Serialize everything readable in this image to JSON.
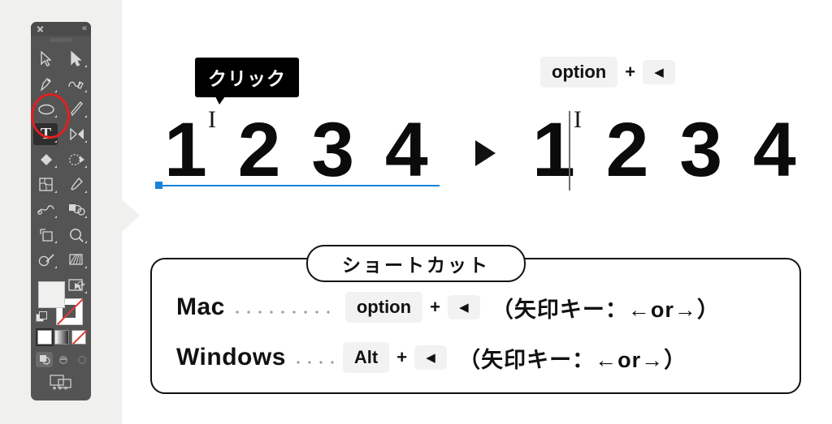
{
  "toolbar": {
    "close_icon": "close-icon",
    "collapse_label": "«",
    "dots_label": "•••",
    "tools": [
      {
        "name": "selection-tool",
        "glyph": "▷"
      },
      {
        "name": "direct-selection-tool",
        "glyph": "▶"
      },
      {
        "name": "pen-tool",
        "glyph": "✒"
      },
      {
        "name": "curvature-tool",
        "glyph": "✎"
      },
      {
        "name": "ellipse-tool",
        "glyph": "⬭"
      },
      {
        "name": "paintbrush-tool",
        "glyph": "╱"
      },
      {
        "name": "type-tool",
        "glyph": "T"
      },
      {
        "name": "touch-type-tool",
        "glyph": "◀"
      },
      {
        "name": "shape-builder-tool",
        "glyph": "◆"
      },
      {
        "name": "live-paint-tool",
        "glyph": "●"
      },
      {
        "name": "gradient-mesh-tool",
        "glyph": "⊞"
      },
      {
        "name": "eyedropper-tool",
        "glyph": "✒"
      },
      {
        "name": "blend-tool",
        "glyph": "∿"
      },
      {
        "name": "symbol-sprayer-tool",
        "glyph": "◐"
      },
      {
        "name": "artboard-tool",
        "glyph": "⬚"
      },
      {
        "name": "zoom-tool",
        "glyph": "⚲"
      },
      {
        "name": "shaper-tool",
        "glyph": "◯"
      },
      {
        "name": "perspective-grid-tool",
        "glyph": "◧"
      },
      {
        "name": "graph-tool",
        "glyph": "▤"
      },
      {
        "name": "slice-tool",
        "glyph": "⬚"
      }
    ],
    "active_tool": "type-tool"
  },
  "tooltip": {
    "text": "クリック"
  },
  "canvas": {
    "before_text": "1 2 3 4",
    "after_text": "1 2 3 4",
    "cursor_icon": "text-ibeam-cursor",
    "arrow_icon": "play-arrow-icon",
    "baseline_color": "#1683d8"
  },
  "top_keys": {
    "modifier": "option",
    "plus": "+",
    "arrow": "◀"
  },
  "shortcut": {
    "title": "ショートカット",
    "rows": [
      {
        "os": "Mac",
        "modifier": "option",
        "plus": "+",
        "arrow": "◀",
        "note": "（矢印キー：←or→）",
        "leader": "long"
      },
      {
        "os": "Windows",
        "modifier": "Alt",
        "plus": "+",
        "arrow": "◀",
        "note": "（矢印キー：←or→）",
        "leader": "short"
      }
    ]
  },
  "colors": {
    "panel_bg": "#f0f0ee",
    "toolbar_bg": "#545454",
    "accent_blue": "#1683d8",
    "highlight_red": "#e02020",
    "key_chip": "#f2f2f2"
  }
}
